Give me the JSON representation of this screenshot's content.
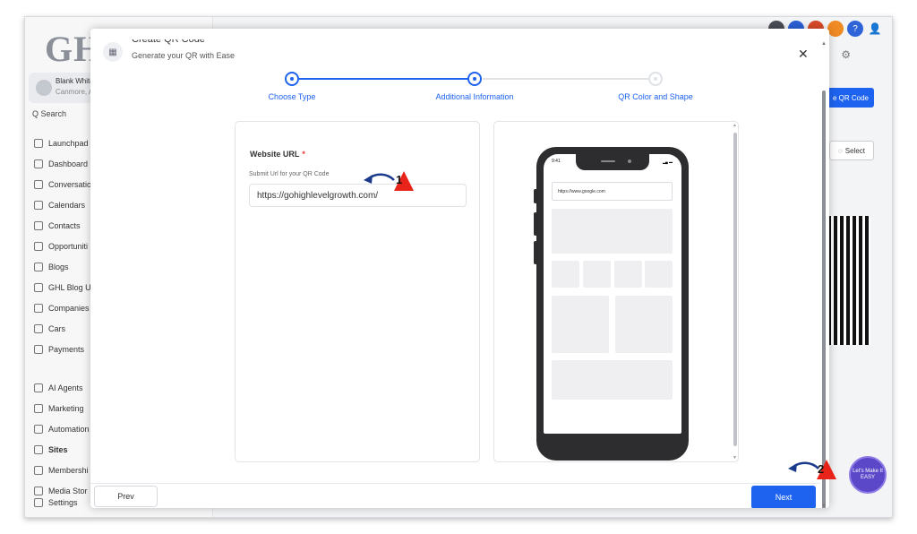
{
  "background": {
    "logo": "GH",
    "account": {
      "name": "Blank WhiteL",
      "location": "Canmore, Al"
    },
    "search": "Q Search",
    "nav": [
      "Launchpad",
      "Dashboard",
      "Conversatio",
      "Calendars",
      "Contacts",
      "Opportuniti",
      "Blogs",
      "GHL Blog U",
      "Companies",
      "Cars",
      "Payments",
      "AI Agents",
      "Marketing",
      "Automation",
      "Sites",
      "Membershi",
      "Media Stor",
      "Settings"
    ],
    "qr_button_label": "e QR Code",
    "select_button_label": "Select",
    "help_badge": "?",
    "corner_badge": "Let's Make It EASY"
  },
  "modal": {
    "title": "Create QR Code",
    "subtitle": "Generate your QR with Ease",
    "close_label": "✕",
    "steps": [
      {
        "label": "Choose Type",
        "status": "done"
      },
      {
        "label": "Additional Information",
        "status": "done"
      },
      {
        "label": "QR Color and Shape",
        "status": "todo"
      }
    ],
    "form": {
      "label": "Website URL",
      "required_mark": "*",
      "hint": "Submit Url for your QR Code",
      "value": "https://gohighlevelgrowth.com/"
    },
    "preview": {
      "time": "9:41",
      "signal": "▂▄ ▬",
      "url": "https://www.google.com"
    },
    "footer": {
      "prev_label": "Prev",
      "next_label": "Next"
    }
  },
  "annotations": {
    "one": "1",
    "two": "2"
  },
  "colors": {
    "accent": "#1e63f0",
    "annotation_red": "#e8231a",
    "arrow_navy": "#1b3a8c"
  }
}
